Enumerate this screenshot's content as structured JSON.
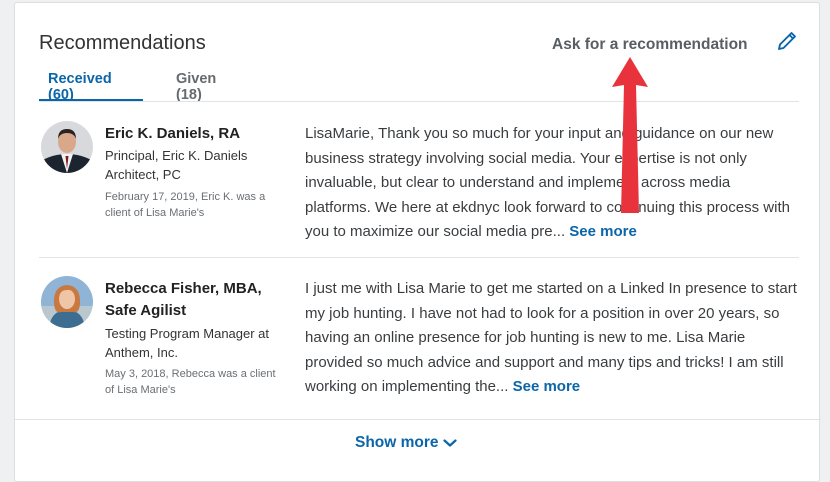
{
  "section": {
    "title": "Recommendations",
    "ask_label": "Ask for a recommendation",
    "edit_icon": "pencil-icon"
  },
  "tabs": [
    {
      "label": "Received (60)",
      "active": true
    },
    {
      "label": "Given (18)",
      "active": false
    }
  ],
  "recommendations": [
    {
      "name": "Eric K. Daniels, RA",
      "headline": "Principal, Eric K. Daniels Architect, PC",
      "meta": "February 17, 2019, Eric K. was a client of Lisa Marie's",
      "text": "LisaMarie, Thank you so much for your input and guidance on our new business strategy involving social media. Your expertise is not only invaluable, but clear to understand and implement across media platforms. We here at ekdnyc look forward to continuing this process with you to maximize our social media pre...",
      "see_more": "See more"
    },
    {
      "name": "Rebecca Fisher, MBA, Safe Agilist",
      "headline": "Testing Program Manager at Anthem, Inc.",
      "meta": "May 3, 2018, Rebecca was a client of Lisa Marie's",
      "text": "I just me with Lisa Marie to get me started on a Linked In presence to start my job hunting. I have not had to look for a position in over 20 years, so having an online presence for job hunting is new to me. Lisa Marie provided so much advice and support and many tips and tricks! I am still working on implementing the...",
      "see_more": "See more"
    }
  ],
  "footer": {
    "show_more_label": "Show more"
  },
  "colors": {
    "accent": "#0a66a8",
    "annotation_arrow": "#e8333c"
  }
}
